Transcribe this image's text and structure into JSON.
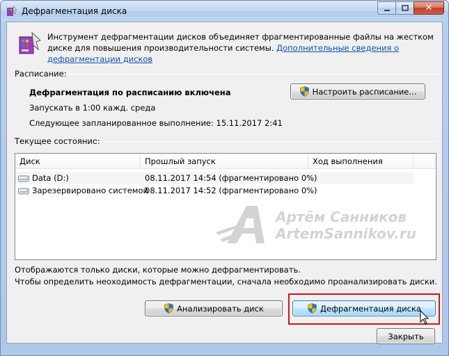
{
  "window": {
    "title": "Дефрагментация диска"
  },
  "intro": {
    "text": "Инструмент дефрагментации дисков объединяет фрагментированные файлы на жестком диске для повышения производительности системы. ",
    "link": "Дополнительные сведения о дефрагментации дисков"
  },
  "schedule": {
    "section_label": "Расписание:",
    "status": "Дефрагментация по расписанию включена",
    "run_at": "Запускать в 1:00 кажд. среда",
    "next_run": "Следующее запланированное выполнение: 15.11.2017 2:41",
    "configure_button": "Настроить расписание..."
  },
  "current": {
    "section_label": "Текущее состояние:",
    "columns": [
      "Диск",
      "Прошлый запуск",
      "Ход выполнения"
    ],
    "rows": [
      {
        "disk": "Data (D:)",
        "last_run": "08.11.2017 14:54 (фрагментировано 0%)",
        "progress": ""
      },
      {
        "disk": "Зарезервировано системой",
        "last_run": "08.11.2017 14:52 (фрагментировано 0%)",
        "progress": ""
      }
    ]
  },
  "watermark": {
    "line1": "Артём Санников",
    "line2": "ArtemSannikov.ru"
  },
  "notes": {
    "line1": "Отображаются только диски, которые можно дефрагментировать.",
    "line2": "Чтобы определить неоходимость  дефрагментации, сначала необходимо проанализировать диски."
  },
  "buttons": {
    "analyze": "Анализировать диск",
    "defragment": "Дефрагментация диска",
    "close": "Закрыть"
  },
  "colors": {
    "link": "#0a53b7",
    "highlight": "#d0141a"
  }
}
